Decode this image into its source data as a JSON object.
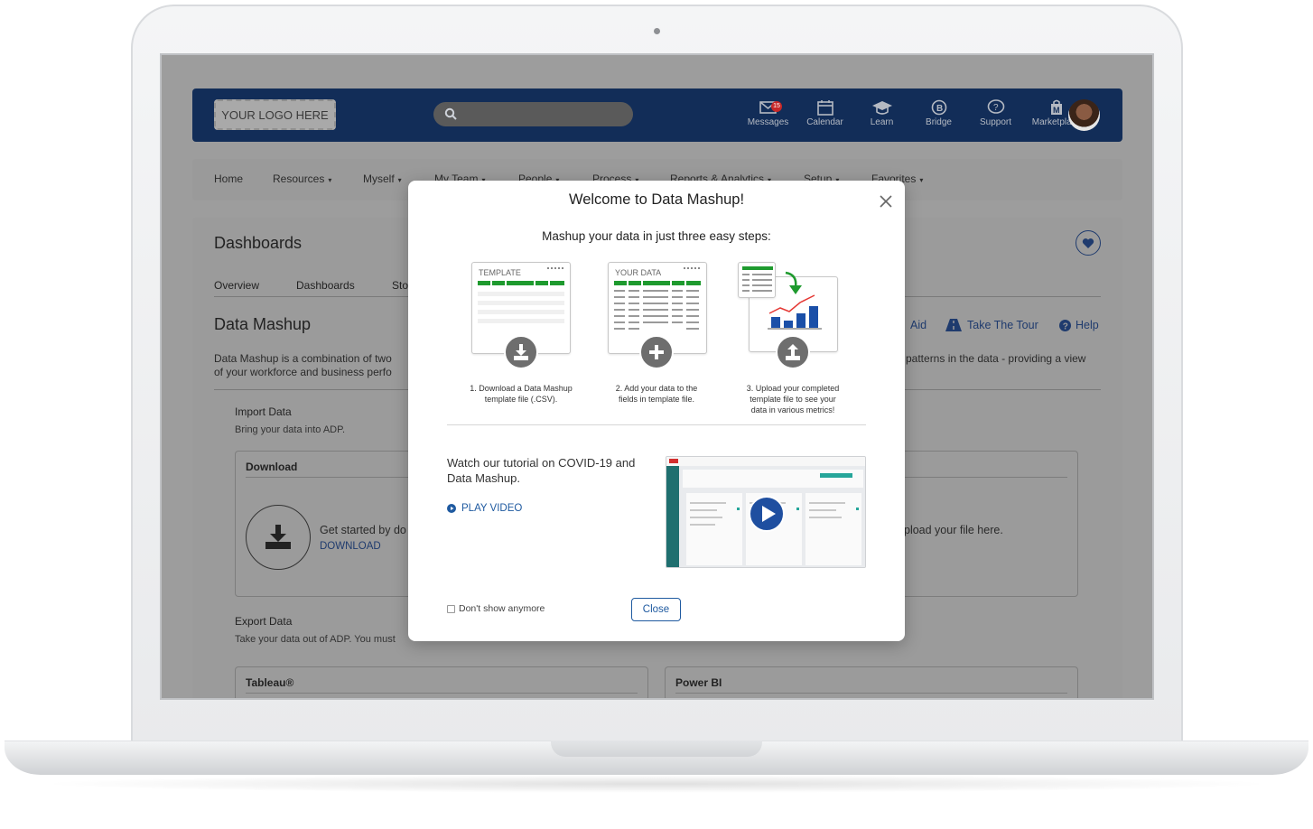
{
  "topbar": {
    "logo_text": "YOUR LOGO HERE",
    "nav": [
      {
        "label": "Messages",
        "icon": "mail-icon",
        "badge": "15"
      },
      {
        "label": "Calendar",
        "icon": "calendar-icon"
      },
      {
        "label": "Learn",
        "icon": "graduation-cap-icon"
      },
      {
        "label": "Bridge",
        "icon": "bridge-chat-icon"
      },
      {
        "label": "Support",
        "icon": "question-bubble-icon"
      },
      {
        "label": "Marketplace",
        "icon": "marketplace-bag-icon"
      }
    ]
  },
  "menu": {
    "items": [
      "Home",
      "Resources",
      "Myself",
      "My Team",
      "People",
      "Process",
      "Reports & Analytics",
      "Setup",
      "Favorites"
    ]
  },
  "page": {
    "title": "Dashboards",
    "tabs": [
      "Overview",
      "Dashboards",
      "Sto"
    ],
    "section_title": "Data Mashup",
    "links": {
      "aid": "Aid",
      "tour": "Take The Tour",
      "help": "Help"
    },
    "description_line1": "Data Mashup is a combination of two",
    "description_line2": "of your workforce and business perfo",
    "description_right": "patterns in the data - providing a view",
    "import": {
      "title": "Import Data",
      "subtitle": "Bring your data into ADP."
    },
    "download_card": {
      "title": "Download",
      "text": "Get started by do",
      "link": "DOWNLOAD"
    },
    "upload_text": "pload your file here.",
    "export": {
      "title": "Export Data",
      "subtitle": "Take your data out of ADP. You must"
    },
    "tableau_card": {
      "title": "Tableau®"
    },
    "powerbi_card": {
      "title": "Power BI"
    }
  },
  "modal": {
    "title": "Welcome to Data Mashup!",
    "subtitle": "Mashup your data in just three easy steps:",
    "steps": [
      {
        "card_label": "TEMPLATE",
        "line1": "1. Download a Data Mashup",
        "line2": "template file (.CSV)."
      },
      {
        "card_label": "YOUR DATA",
        "line1": "2. Add your data to the",
        "line2": "fields in template file."
      },
      {
        "line1": "3. Upload your completed",
        "line2": "template file to see your",
        "line3": "data in various metrics!"
      }
    ],
    "tutorial_text": "Watch our tutorial on COVID-19 and Data Mashup.",
    "play_label": "PLAY VIDEO",
    "dont_show_label": "Don't show anymore",
    "close_label": "Close"
  },
  "colors": {
    "topbar": "#122d58",
    "link": "#1f5aa0",
    "green": "#1e9a2e",
    "bar_blue": "#1a4fa8",
    "play_blue": "#1f4fa0"
  }
}
